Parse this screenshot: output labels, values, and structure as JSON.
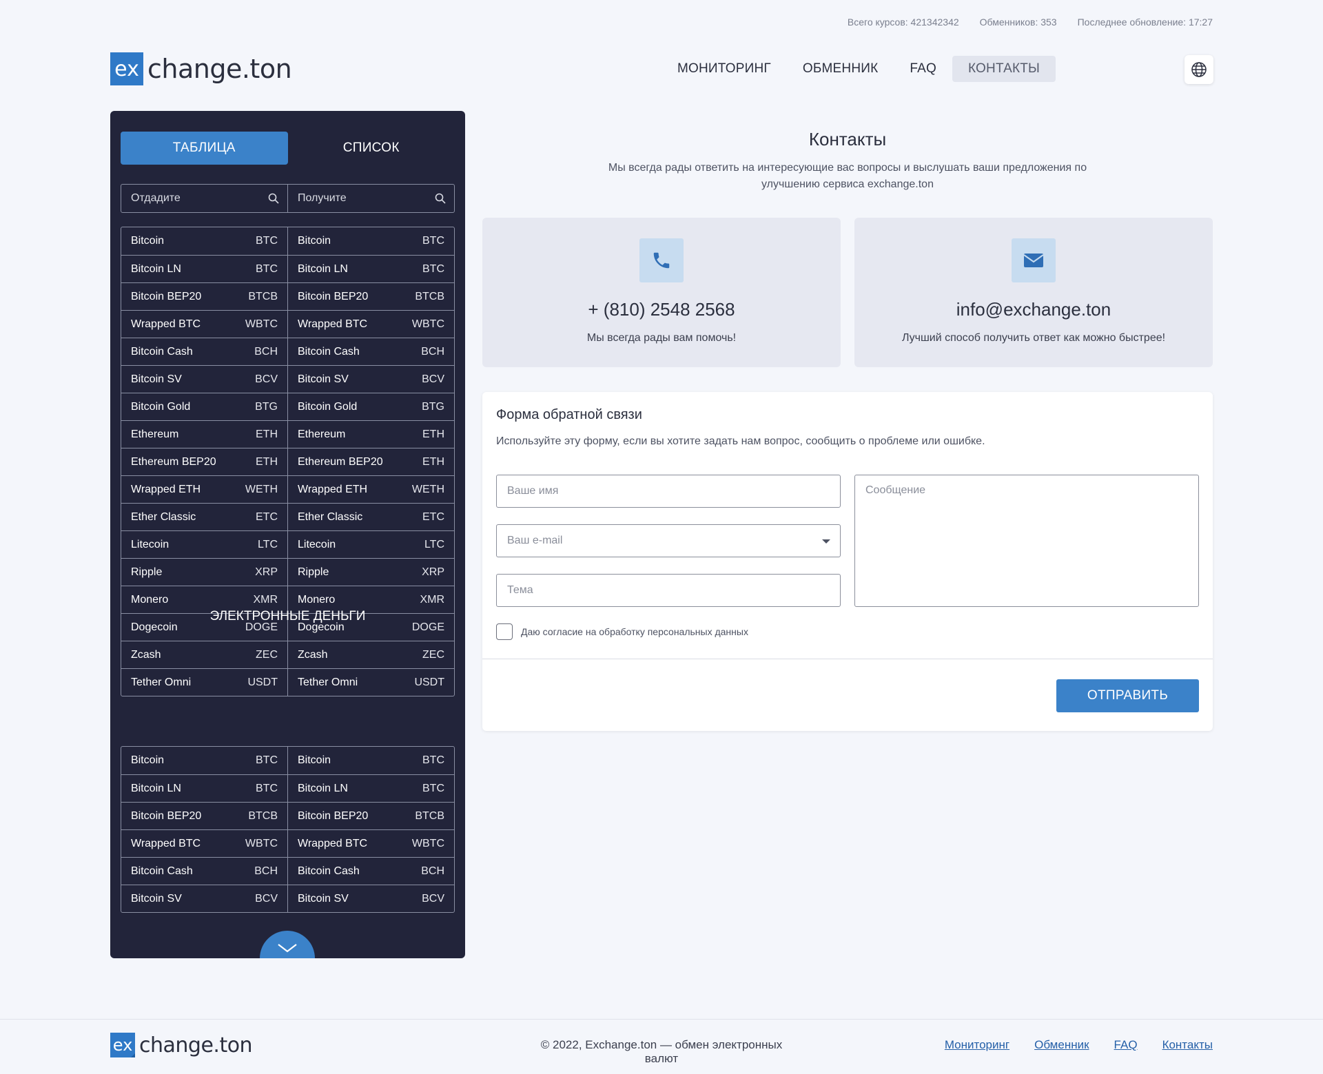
{
  "top_stats": {
    "rates": "Всего курсов: 421342342",
    "exchangers": "Обменников: 353",
    "updated": "Последнее обновление: 17:27"
  },
  "logo": {
    "mark": "ex",
    "word": "change.ton"
  },
  "nav": {
    "items": [
      {
        "label": "МОНИТОРИНГ",
        "active": false
      },
      {
        "label": "ОБМЕННИК",
        "active": false
      },
      {
        "label": "FAQ",
        "active": false
      },
      {
        "label": "КОНТАКТЫ",
        "active": true
      }
    ],
    "language_icon": "globe-icon"
  },
  "sidebar": {
    "tabs": [
      {
        "label": "ТАБЛИЦА",
        "active": true
      },
      {
        "label": "СПИСОК",
        "active": false
      }
    ],
    "search": {
      "give_placeholder": "Отдадите",
      "get_placeholder": "Получите"
    },
    "crypto_rows": [
      {
        "name": "Bitcoin",
        "code": "BTC"
      },
      {
        "name": "Bitcoin LN",
        "code": "BTC"
      },
      {
        "name": "Bitcoin BEP20",
        "code": "BTCB"
      },
      {
        "name": "Wrapped BTC",
        "code": "WBTC"
      },
      {
        "name": "Bitcoin Cash",
        "code": "BCH"
      },
      {
        "name": "Bitcoin SV",
        "code": "BCV"
      },
      {
        "name": "Bitcoin Gold",
        "code": "BTG"
      },
      {
        "name": "Ethereum",
        "code": "ETH"
      },
      {
        "name": "Ethereum BEP20",
        "code": "ETH"
      },
      {
        "name": "Wrapped ETH",
        "code": "WETH"
      },
      {
        "name": "Ether Classic",
        "code": "ETC"
      },
      {
        "name": "Litecoin",
        "code": "LTC"
      },
      {
        "name": "Ripple",
        "code": "XRP"
      },
      {
        "name": "Monero",
        "code": "XMR"
      },
      {
        "name": "Dogecoin",
        "code": "DOGE"
      },
      {
        "name": "Zcash",
        "code": "ZEC"
      },
      {
        "name": "Tether Omni",
        "code": "USDT"
      }
    ],
    "emoney_title": "ЭЛЕКТРОННЫЕ ДЕНЬГИ",
    "emoney_rows": [
      {
        "name": "Bitcoin",
        "code": "BTC"
      },
      {
        "name": "Bitcoin LN",
        "code": "BTC"
      },
      {
        "name": "Bitcoin BEP20",
        "code": "BTCB"
      },
      {
        "name": "Wrapped BTC",
        "code": "WBTC"
      },
      {
        "name": "Bitcoin Cash",
        "code": "BCH"
      },
      {
        "name": "Bitcoin SV",
        "code": "BCV"
      }
    ],
    "more_icon": "chevron-down-icon"
  },
  "contacts": {
    "title": "Контакты",
    "subtitle": "Мы всегда рады ответить на интересующие вас вопросы и выслушать ваши предложения по улучшению сервиса exchange.ton",
    "phone": {
      "icon": "phone-icon",
      "value": "+ (810) 2548 2568",
      "note": "Мы всегда рады вам помочь!"
    },
    "email": {
      "icon": "envelope-icon",
      "value": "info@exchange.ton",
      "note": "Лучший способ получить ответ как можно быстрее!"
    }
  },
  "form": {
    "title": "Форма обратной связи",
    "description": "Используйте эту форму, если вы хотите задать нам вопрос, сообщить о проблеме или ошибке.",
    "name_placeholder": "Ваше имя",
    "email_placeholder": "Ваш e-mail",
    "subject_placeholder": "Тема",
    "message_placeholder": "Сообщение",
    "consent_label": "Даю согласие на обработку персональных данных",
    "submit_label": "ОТПРАВИТЬ"
  },
  "footer": {
    "copyright": "© 2022, Exchange.ton — обмен электронных валют",
    "links": [
      "Мониторинг",
      "Обменник",
      "FAQ",
      "Контакты"
    ]
  },
  "colors": {
    "accent": "#3b82c9",
    "sidebar_bg": "#22243a",
    "page_bg": "#f4f6fb",
    "card_bg": "#e6e8f1"
  }
}
